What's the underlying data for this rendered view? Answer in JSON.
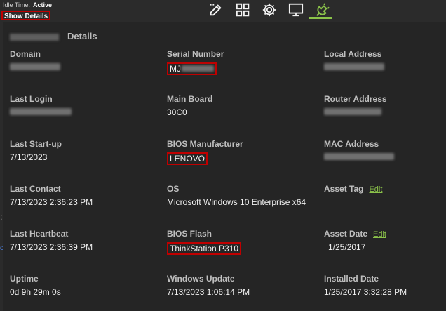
{
  "status": {
    "idle_label": "Idle Time:",
    "idle_value": "Active"
  },
  "show_details_label": "Show Details",
  "toolbar": {
    "icons": [
      "edit-icon",
      "grid-icon",
      "gear-icon",
      "monitor-icon",
      "plug-icon"
    ],
    "accent": "#8bc34a"
  },
  "panel": {
    "title": "Details"
  },
  "fields": {
    "domain": {
      "label": "Domain"
    },
    "serial_number": {
      "label": "Serial Number",
      "value": "MJ"
    },
    "local_address": {
      "label": "Local Address"
    },
    "last_login": {
      "label": "Last Login"
    },
    "main_board": {
      "label": "Main Board",
      "value": "30C0"
    },
    "router_address": {
      "label": "Router Address"
    },
    "last_startup": {
      "label": "Last Start-up",
      "value": "7/13/2023"
    },
    "bios_manufacturer": {
      "label": "BIOS Manufacturer",
      "value": "LENOVO"
    },
    "mac_address": {
      "label": "MAC Address"
    },
    "last_contact": {
      "label": "Last Contact",
      "value": "7/13/2023 2:36:23 PM"
    },
    "os": {
      "label": "OS",
      "value": "Microsoft Windows 10 Enterprise x64"
    },
    "asset_tag": {
      "label": "Asset Tag",
      "edit": "Edit"
    },
    "last_heartbeat": {
      "label": "Last Heartbeat",
      "value": "7/13/2023 2:36:39 PM"
    },
    "bios_flash": {
      "label": "BIOS Flash",
      "value": "ThinkStation P310"
    },
    "asset_date": {
      "label": "Asset Date",
      "edit": "Edit",
      "value": "1/25/2017"
    },
    "uptime": {
      "label": "Uptime",
      "value": "0d 9h 29m 0s"
    },
    "windows_update": {
      "label": "Windows Update",
      "value": "7/13/2023 1:06:14 PM"
    },
    "installed_date": {
      "label": "Installed Date",
      "value": "1/25/2017 3:32:28 PM"
    }
  },
  "edge_fragments": {
    "a": ":",
    "b": "c"
  }
}
